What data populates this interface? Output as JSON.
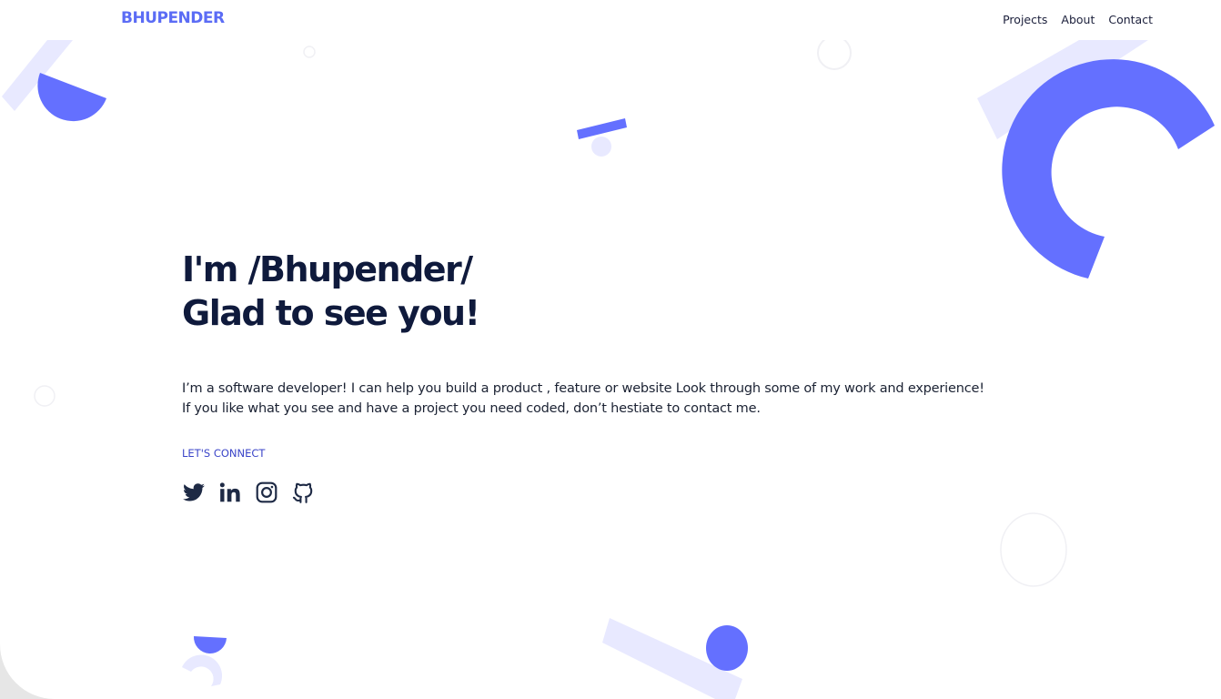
{
  "brand": {
    "logo": "BHUPENDER"
  },
  "nav": {
    "items": [
      {
        "label": "Projects"
      },
      {
        "label": "About"
      },
      {
        "label": "Contact"
      }
    ]
  },
  "hero": {
    "line1": "I'm /Bhupender/",
    "line2": "Glad to see you!"
  },
  "intro": {
    "line1": "I’m a software developer! I can help you build a product , feature or website Look through some of my work and experience!",
    "line2": "If you like what you see and have a project you need coded, don’t hestiate to contact me."
  },
  "connect": {
    "label": "LET'S CONNECT"
  },
  "socials": [
    {
      "icon": "twitter-icon"
    },
    {
      "icon": "linkedin-icon"
    },
    {
      "icon": "instagram-icon"
    },
    {
      "icon": "github-icon"
    }
  ],
  "colors": {
    "accent": "#5b6cf5",
    "shape": "#6470ff",
    "shape_light": "#e8e9ff",
    "heading": "#0f1a3c",
    "text": "#1b2233",
    "connect": "#3b45c8"
  }
}
